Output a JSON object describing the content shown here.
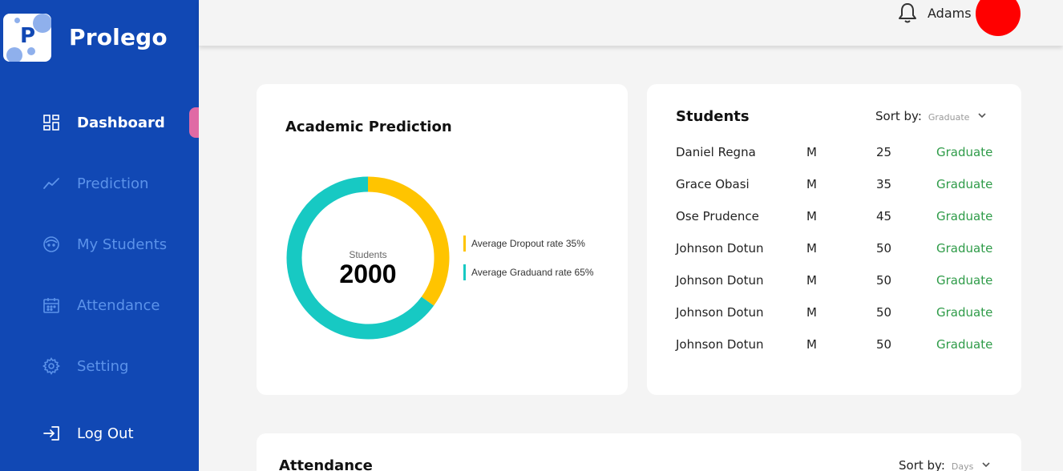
{
  "sidebar": {
    "logo_letter": "P",
    "brand": "Prolego",
    "items": [
      {
        "label": "Dashboard",
        "icon": "dashboard-icon"
      },
      {
        "label": "Prediction",
        "icon": "trend-icon"
      },
      {
        "label": "My Students",
        "icon": "student-face-icon"
      },
      {
        "label": "Attendance",
        "icon": "calendar-icon"
      },
      {
        "label": "Setting",
        "icon": "gear-icon"
      }
    ],
    "logout_label": "Log Out"
  },
  "topbar": {
    "username": "Adams",
    "notification_icon": "bell-icon"
  },
  "prediction": {
    "title": "Academic Prediction",
    "center_label": "Students",
    "center_value": "2000",
    "legend": [
      {
        "label": "Average Dropout rate 35%",
        "color": "#ffc400"
      },
      {
        "label": "Average Graduand rate 65%",
        "color": "#17c9c3"
      }
    ]
  },
  "chart_data": {
    "type": "pie",
    "categories": [
      "Average Dropout rate",
      "Average Graduand rate"
    ],
    "values": [
      35,
      65
    ],
    "colors": [
      "#ffc400",
      "#17c9c3"
    ]
  },
  "students": {
    "title": "Students",
    "sort_label": "Sort by:",
    "sort_value": "Graduate",
    "rows": [
      {
        "name": "Daniel Regna",
        "gender": "M",
        "age": "25",
        "status": "Graduate"
      },
      {
        "name": "Grace Obasi",
        "gender": "M",
        "age": "35",
        "status": "Graduate"
      },
      {
        "name": "Ose Prudence",
        "gender": "M",
        "age": "45",
        "status": "Graduate"
      },
      {
        "name": "Johnson Dotun",
        "gender": "M",
        "age": "50",
        "status": "Graduate"
      },
      {
        "name": "Johnson Dotun",
        "gender": "M",
        "age": "50",
        "status": "Graduate"
      },
      {
        "name": "Johnson Dotun",
        "gender": "M",
        "age": "50",
        "status": "Graduate"
      },
      {
        "name": "Johnson Dotun",
        "gender": "M",
        "age": "50",
        "status": "Graduate"
      }
    ]
  },
  "attendance": {
    "title": "Attendance",
    "sort_label": "Sort by:",
    "sort_value": "Days"
  },
  "colors": {
    "sidebar": "#1148b4",
    "active_marker": "#e06aa5",
    "status_green": "#2e9b48",
    "avatar": "#ff0000"
  }
}
